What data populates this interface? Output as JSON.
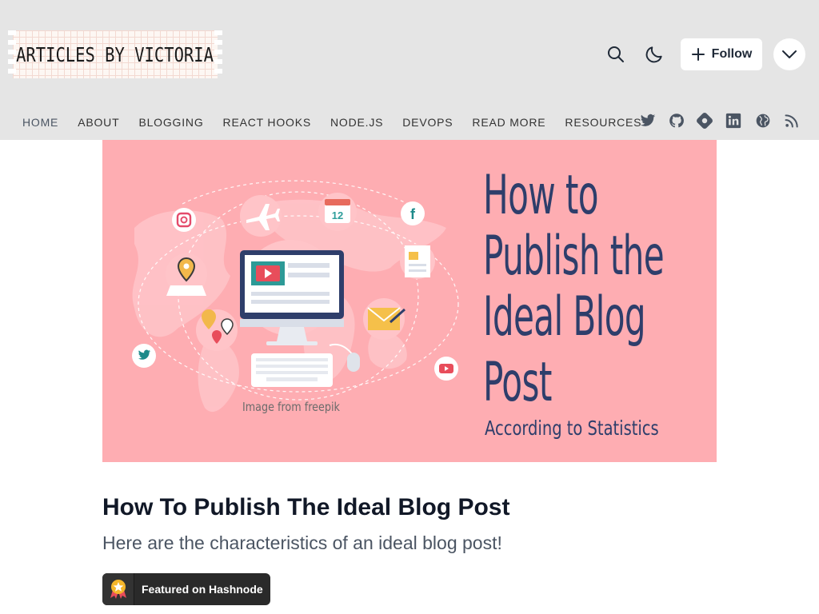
{
  "header": {
    "logo_text": "ARTICLES BY VICTORIA",
    "search_icon": "search-icon",
    "theme_icon": "moon-icon",
    "follow_label": "Follow",
    "menu_icon": "chevron-down-icon"
  },
  "nav": {
    "items": [
      "HOME",
      "ABOUT",
      "BLOGGING",
      "REACT HOOKS",
      "NODE.JS",
      "DEVOPS",
      "READ MORE",
      "RESOURCES"
    ],
    "active": "HOME",
    "social_icons": [
      "twitter-icon",
      "github-icon",
      "hashnode-icon",
      "linkedin-icon",
      "globe-icon",
      "rss-icon"
    ]
  },
  "cover": {
    "title_lines": [
      "How to",
      "Publish the",
      "Ideal Blog",
      "Post"
    ],
    "subtitle": "According to Statistics",
    "credit": "Image from freepik",
    "calendar_day": "12",
    "background_color": "#feadb2",
    "text_color": "#2e3e6b"
  },
  "post": {
    "title": "How To Publish The Ideal Blog Post",
    "subtitle": "Here are the characteristics of an ideal blog post!",
    "badge_label": "Featured on Hashnode"
  }
}
